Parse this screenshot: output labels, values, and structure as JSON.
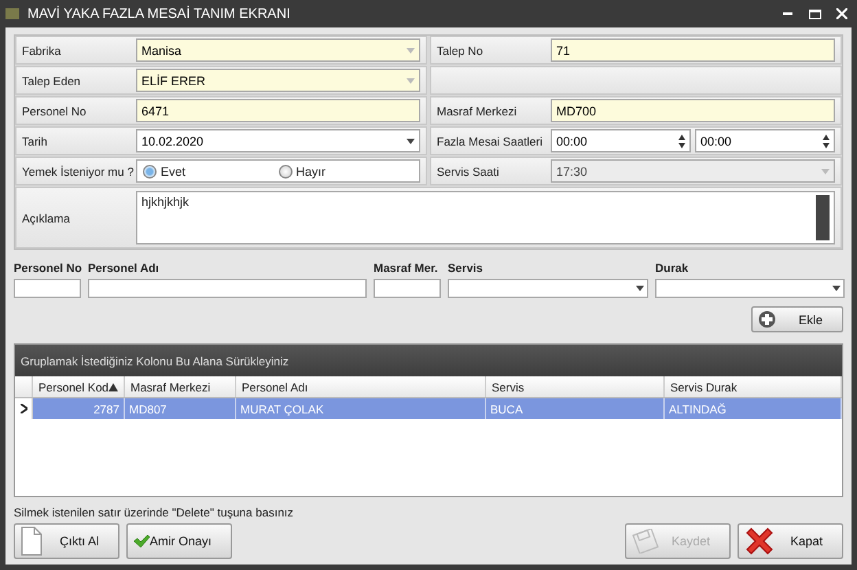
{
  "window": {
    "title": "MAVİ YAKA FAZLA MESAİ TANIM EKRANI"
  },
  "form": {
    "rows": [
      [
        {
          "label": "Fabrika",
          "kind": "combo",
          "value": "Manisa",
          "readonly": true,
          "disabled": false
        },
        {
          "label": "Talep No",
          "kind": "text",
          "value": "71",
          "readonly": true,
          "disabled": false
        }
      ],
      [
        {
          "label": "Talep Eden",
          "kind": "combo",
          "value": "ELİF ERER",
          "readonly": true,
          "disabled": false
        }
      ],
      [
        {
          "label": "Personel No",
          "kind": "text",
          "value": "6471",
          "readonly": true,
          "disabled": false
        },
        {
          "label": "Masraf Merkezi",
          "kind": "text",
          "value": "MD700",
          "readonly": true,
          "disabled": false
        }
      ],
      [
        {
          "label": "Tarih",
          "kind": "date",
          "value": "10.02.2020",
          "readonly": false,
          "disabled": false
        },
        {
          "label": "Fazla Mesai Saatleri",
          "kind": "spin",
          "values": [
            "00:00",
            "00:00"
          ],
          "readonly": false,
          "disabled": false
        }
      ],
      [
        {
          "label": "Yemek İsteniyor mu ?",
          "kind": "radio",
          "options": [
            {
              "label": "Evet",
              "selected": true
            },
            {
              "label": "Hayır",
              "selected": false
            }
          ]
        },
        {
          "label": "Servis Saati",
          "kind": "combo",
          "value": "17:30",
          "readonly": false,
          "disabled": true
        }
      ]
    ],
    "description": {
      "label": "Açıklama",
      "value": "hjkhjkhjk"
    }
  },
  "entry": {
    "columns": [
      {
        "label": "Personel No",
        "kind": "text"
      },
      {
        "label": "Personel Adı",
        "kind": "text"
      },
      {
        "label": "Masraf Mer.",
        "kind": "text"
      },
      {
        "label": "Servis",
        "kind": "combo"
      },
      {
        "label": "Durak",
        "kind": "combo"
      }
    ],
    "add_button": "Ekle"
  },
  "grid": {
    "group_panel": "Gruplamak İstediğiniz Kolonu Bu Alana Sürükleyiniz",
    "columns": [
      {
        "label": "Personel Kod",
        "sorted": true,
        "kind": "number"
      },
      {
        "label": "Masraf Merkezi",
        "sorted": false,
        "kind": "text"
      },
      {
        "label": "Personel Adı",
        "sorted": false,
        "kind": "text"
      },
      {
        "label": "Servis",
        "sorted": false,
        "kind": "text"
      },
      {
        "label": "Servis Durak",
        "sorted": false,
        "kind": "text"
      }
    ],
    "rows": [
      {
        "cells": [
          "2787",
          "MD807",
          "MURAT ÇOLAK",
          "BUCA",
          "ALTINDAĞ"
        ],
        "selected": true
      }
    ]
  },
  "hint": "Silmek istenilen satır üzerinde \"Delete\" tuşuna basınız",
  "buttons": [
    {
      "label": "Çıktı Al",
      "kind": "document",
      "disabled": false
    },
    {
      "label": "Amir Onayı",
      "kind": "check",
      "disabled": false
    },
    {
      "label": "Kaydet",
      "kind": "save",
      "disabled": true
    },
    {
      "label": "Kapat",
      "kind": "close",
      "disabled": false
    }
  ]
}
